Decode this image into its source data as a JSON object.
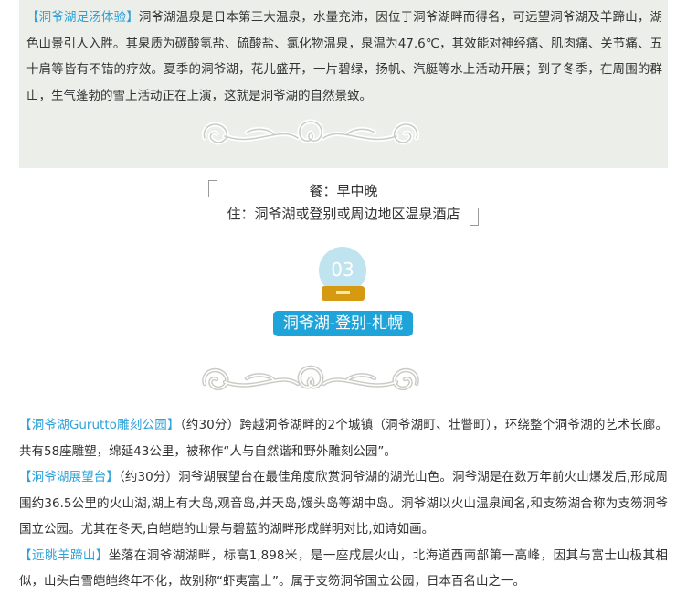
{
  "intro": {
    "tag": "【洞爷湖足汤体验】",
    "text": "洞爷湖温泉是日本第三大温泉，水量充沛，因位于洞爷湖畔而得名，可远望洞爷湖及羊蹄山，湖色山景引人入胜。其泉质为碳酸氢盐、硫酸盐、氯化物温泉，泉温为47.6℃，其效能对神经痛、肌肉痛、关节痛、五十肩等皆有不错的疗效。夏季的洞爷湖，花儿盛开，一片碧绿，扬帆、汽艇等水上活动开展；到了冬季，在周围的群山，生气蓬勃的雪上活动正在上演，这就是洞爷湖的自然景致。"
  },
  "info": {
    "meals": "餐：早中晚",
    "stay": "住：洞爷湖或登别或周边地区温泉酒店"
  },
  "day": {
    "number": "03",
    "title": "洞爷湖-登别-札幌"
  },
  "spots": [
    {
      "tag": "【洞爷湖Gurutto雕刻公园】",
      "text": "（约30分）跨越洞爷湖畔的2个城镇（洞爷湖町、壮瞥町），环绕整个洞爷湖的艺术长廊。共有58座雕塑，绵延43公里，被称作“人与自然谐和野外雕刻公园”。"
    },
    {
      "tag": "【洞爷湖展望台】",
      "text": "（约30分）洞爷湖展望台在最佳角度欣赏洞爷湖的湖光山色。洞爷湖是在数万年前火山爆发后,形成周围约36.5公里的火山湖,湖上有大岛,观音岛,并天岛,馒头岛等湖中岛。洞爷湖以火山温泉闻名,和支笏湖合称为支笏洞爷国立公园。尤其在冬天,白皑皑的山景与碧蓝的湖畔形成鲜明对比,如诗如画。"
    },
    {
      "tag": "【远眺羊蹄山】",
      "text": "坐落在洞爷湖湖畔，标高1,898米，是一座成层火山，北海道西南部第一高峰，因其与富士山极其相似，山头白雪皑皑终年不化，故别称“虾夷富士”。属于支笏洞爷国立公园，日本百名山之一。"
    }
  ],
  "colors": {
    "accent": "#2ea2d8",
    "title_bg": "#1fa4da",
    "panel_bg": "#ecefe9",
    "badge_circle": "#bfe4ef",
    "badge_base": "#d59a12"
  },
  "icons": {
    "ornament": "swirl-divider-icon",
    "badge": "day-number-badge"
  }
}
